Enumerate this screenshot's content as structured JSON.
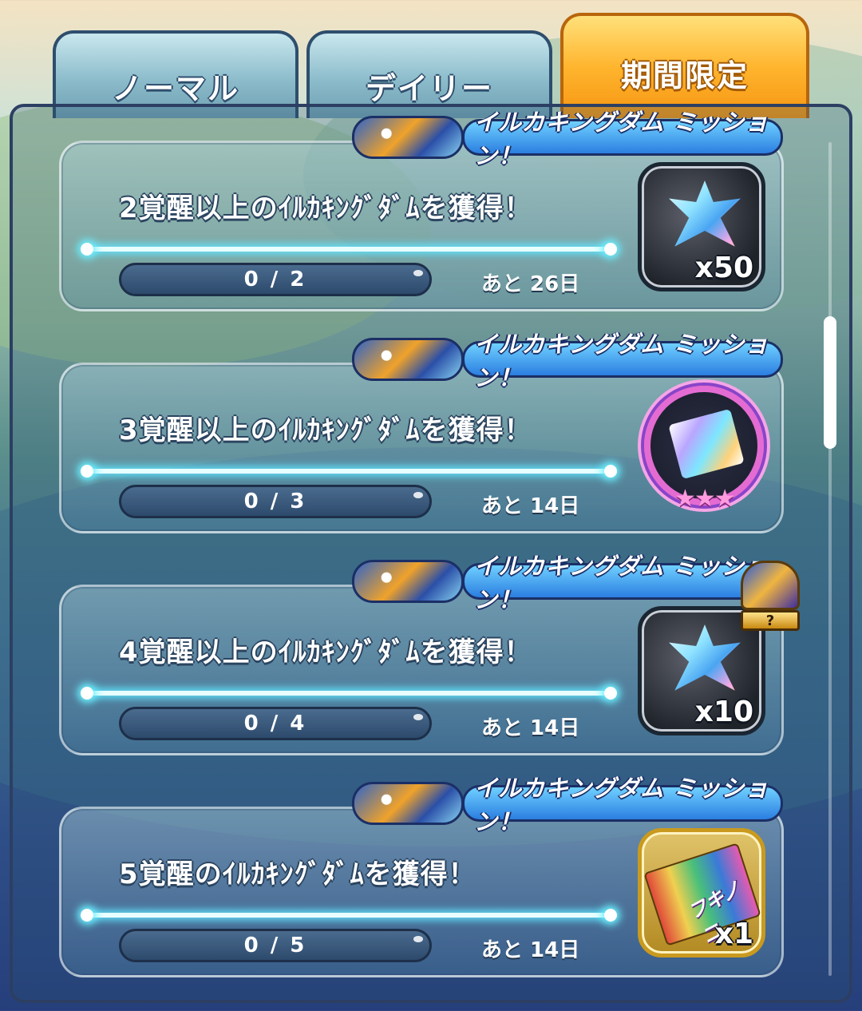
{
  "tabs": [
    {
      "label": "ノーマル",
      "active": false
    },
    {
      "label": "デイリー",
      "active": false
    },
    {
      "label": "期間限定",
      "active": true
    }
  ],
  "missions": [
    {
      "banner": "イルカキングダム ミッション！",
      "title": "2覚醒以上のｲﾙｶｷﾝｸﾞﾀﾞﾑを獲得！",
      "progress": "0 / 2",
      "remaining": "あと 26日",
      "reward": {
        "icon": "crystal-icon",
        "qty": "x50"
      }
    },
    {
      "banner": "イルカキングダム ミッション！",
      "title": "3覚醒以上のｲﾙｶｷﾝｸﾞﾀﾞﾑを獲得！",
      "progress": "0 / 3",
      "remaining": "あと 14日",
      "reward": {
        "icon": "rainbow-medal-icon",
        "stars": "★★★"
      }
    },
    {
      "banner": "イルカキングダム ミッション！",
      "title": "4覚醒以上のｲﾙｶｷﾝｸﾞﾀﾞﾑを獲得！",
      "progress": "0 / 4",
      "remaining": "あと 14日",
      "reward": {
        "icon": "crystal-icon",
        "qty": "x10"
      }
    },
    {
      "banner": "イルカキングダム ミッション！",
      "title": "5覚醒のｲﾙｶｷﾝｸﾞﾀﾞﾑを獲得！",
      "progress": "0 / 5",
      "remaining": "あと 14日",
      "reward": {
        "icon": "ticket-icon",
        "ticket_text": "フキノコ",
        "qty": "x1"
      }
    }
  ],
  "treasure_badge": {
    "icon": "treasure-chest-icon",
    "label": "?"
  },
  "colors": {
    "active_tab": "#ffb52e",
    "tab": "#8cbccb",
    "glow": "#5fe6ff"
  }
}
